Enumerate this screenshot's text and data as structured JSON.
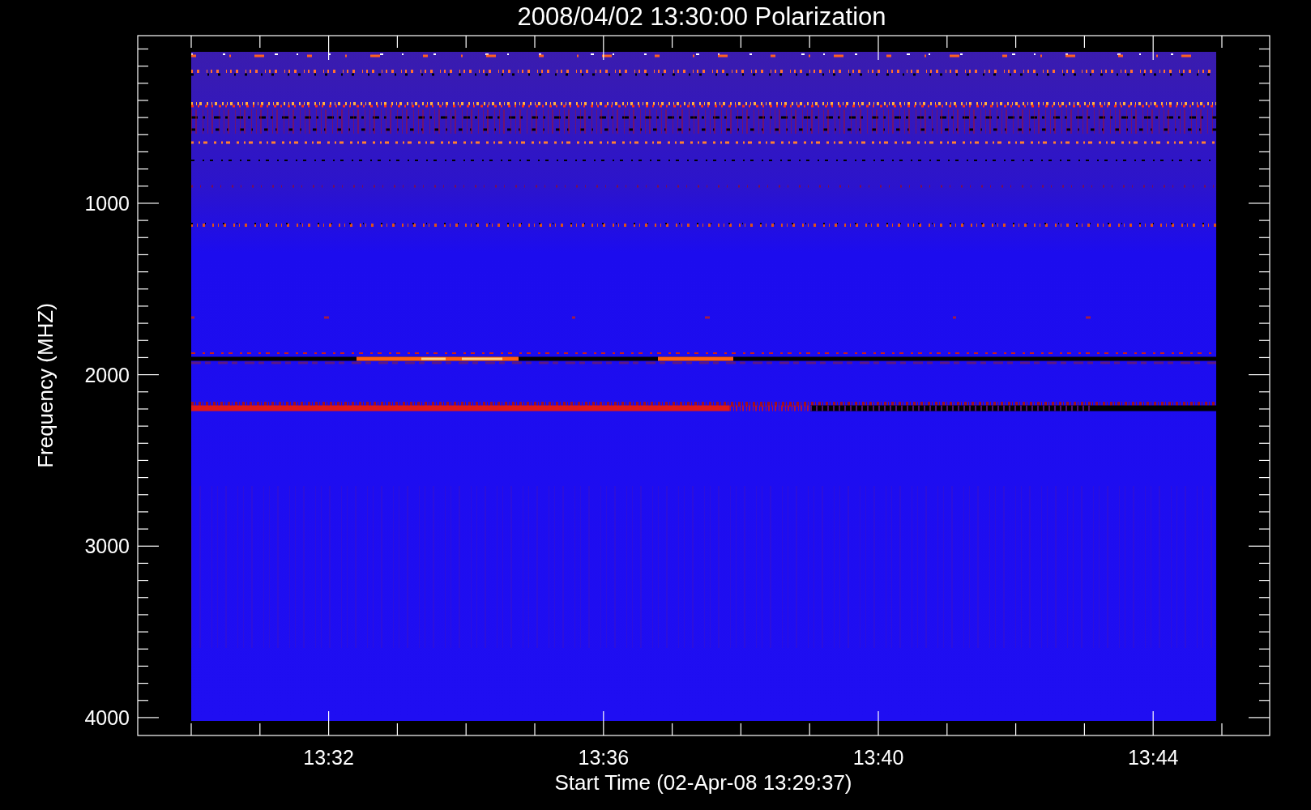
{
  "title": "2008/04/02 13:30:00 Polarization",
  "y_axis": {
    "label": "Frequency (MHZ)",
    "tick_labels": [
      "1000",
      "2000",
      "3000",
      "4000"
    ]
  },
  "x_axis": {
    "label": "Start Time (02-Apr-08 13:29:37)",
    "tick_labels": [
      "13:32",
      "13:36",
      "13:40",
      "13:44"
    ]
  }
}
